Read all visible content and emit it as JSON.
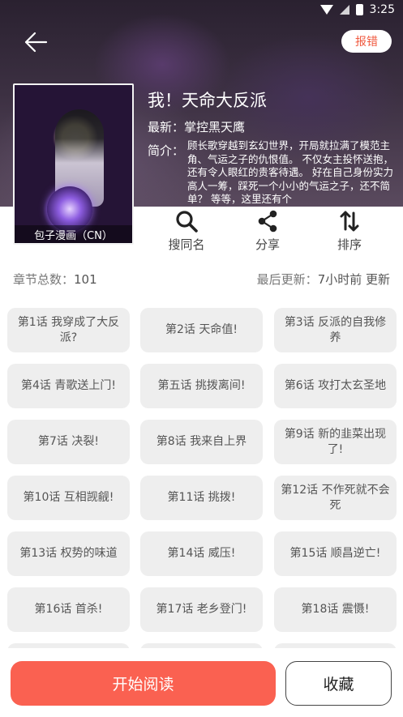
{
  "status_bar": {
    "time": "3:25"
  },
  "header": {
    "back_icon": "arrow-left-icon",
    "report_label": "报错"
  },
  "comic": {
    "title": "我！天命大反派",
    "latest_label": "最新：",
    "latest_value": "掌控黑天鹰",
    "desc_label": "简介：",
    "description": "顾长歌穿越到玄幻世界，开局就拉满了模范主角、气运之子的仇恨值。 不仅女主投怀送抱，还有令人眼红的贵客待遇。 好在自己身份实力高人一筹，踩死一个小小的气运之子，还不简单？ 等等，这里还有个",
    "cover_source": "包子漫画（CN）"
  },
  "actions": [
    {
      "label": "搜同名",
      "icon": "search-icon"
    },
    {
      "label": "分享",
      "icon": "share-icon"
    },
    {
      "label": "排序",
      "icon": "sort-icon"
    }
  ],
  "stats": {
    "total_label": "章节总数：",
    "total_value": "101",
    "updated_label": "最后更新：",
    "updated_value": "7小时前 更新"
  },
  "chapters": [
    "第1话 我穿成了大反派?",
    "第2话 天命值!",
    "第3话 反派的自我修养",
    "第4话 青歌送上门!",
    "第五话 挑拨离间!",
    "第6话 攻打太玄圣地",
    "第7话 决裂!",
    "第8话 我来自上界",
    "第9话 新的韭菜出现了!",
    "第10话 互相觊觎!",
    "第11话 挑拨!",
    "第12话 不作死就不会死",
    "第13话 权势的味道",
    "第14话 威压!",
    "第15话 顺昌逆亡!",
    "第16话 首杀!",
    "第17话 老乡登门!",
    "第18话 震慑!",
    "",
    "",
    ""
  ],
  "bottom": {
    "start_label": "开始阅读",
    "favorite_label": "收藏"
  },
  "colors": {
    "accent": "#fa6151",
    "report_text": "#f05a40",
    "chip_bg": "#eeeeee"
  }
}
